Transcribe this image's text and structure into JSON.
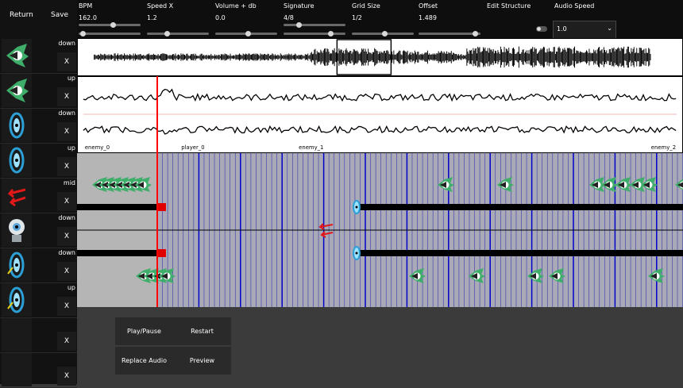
{
  "left_panel": {
    "return_label": "Return",
    "save_label": "Save",
    "rows": [
      {
        "direction": "down",
        "close": "X",
        "icon": "green-spiky-enemy-icon"
      },
      {
        "direction": "up",
        "close": "X",
        "icon": "green-spiky-enemy-icon"
      },
      {
        "direction": "down",
        "close": "X",
        "icon": "blue-portal-icon"
      },
      {
        "direction": "up",
        "close": "X",
        "icon": "blue-portal-icon"
      },
      {
        "direction": "mid",
        "close": "X",
        "icon": "red-arrows-icon"
      },
      {
        "direction": "down",
        "close": "X",
        "icon": "robot-head-icon"
      },
      {
        "direction": "down",
        "close": "X",
        "icon": "blue-portal-arrow-icon"
      },
      {
        "direction": "up",
        "close": "X",
        "icon": "blue-portal-arrow-icon"
      },
      {
        "direction": "",
        "close": "X",
        "icon": ""
      },
      {
        "direction": "",
        "close": "X",
        "icon": ""
      }
    ]
  },
  "toolbar": {
    "bpm": {
      "label": "BPM",
      "value": "162.0"
    },
    "speed_x": {
      "label": "Speed X",
      "value": "1.2"
    },
    "volume": {
      "label": "Volume + db",
      "value": "0.0"
    },
    "signature": {
      "label": "Signature",
      "value": "4/8"
    },
    "grid_size": {
      "label": "Grid Size",
      "value": "1/2"
    },
    "offset": {
      "label": "Offset",
      "value": "1.489"
    },
    "edit_structure": {
      "label": "Edit Structure"
    },
    "audio_speed": {
      "label": "Audio Speed",
      "value": "1.0"
    }
  },
  "timeline": {
    "markers": [
      "enemy_0",
      "player_0",
      "enemy_1",
      "enemy_2"
    ]
  },
  "buttons": {
    "play_pause": "Play/Pause",
    "restart": "Restart",
    "replace_audio": "Replace Audio",
    "preview": "Preview"
  },
  "colors": {
    "accent": "#ff0000",
    "grid_line": "#0000cc",
    "grid_bg": "#a9a9b8",
    "toolbar_bg": "#0e0e0e"
  }
}
